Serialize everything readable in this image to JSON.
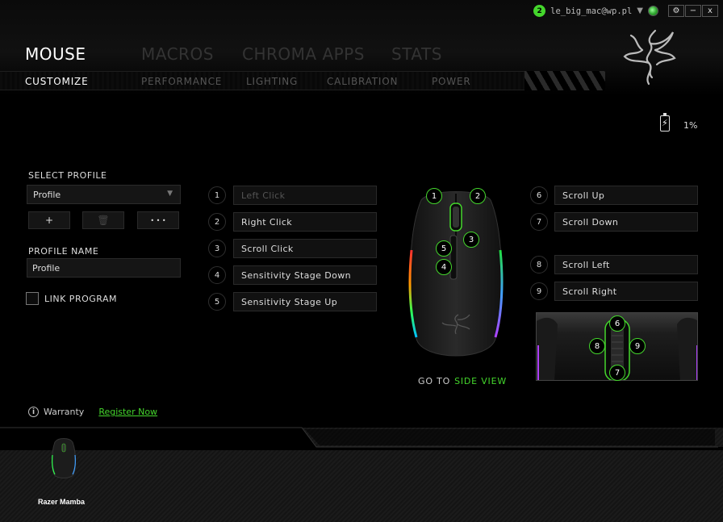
{
  "topbar": {
    "notifications": "2",
    "username": "le_big_mac@wp.pl",
    "settings_label": "⚙",
    "minimize_label": "−",
    "close_label": "x"
  },
  "main_tabs": [
    {
      "label": "MOUSE",
      "active": true
    },
    {
      "label": "MACROS",
      "active": false
    },
    {
      "label": "CHROMA APPS",
      "active": false
    },
    {
      "label": "STATS",
      "active": false
    }
  ],
  "sub_tabs": [
    {
      "label": "CUSTOMIZE",
      "active": true
    },
    {
      "label": "PERFORMANCE",
      "active": false
    },
    {
      "label": "LIGHTING",
      "active": false
    },
    {
      "label": "CALIBRATION",
      "active": false
    },
    {
      "label": "POWER",
      "active": false
    }
  ],
  "battery": {
    "level_percent": 1,
    "label": "1%"
  },
  "profile": {
    "select_label": "SELECT PROFILE",
    "selected": "Profile",
    "add_label": "+",
    "delete_label": "🗑",
    "more_label": "• • •",
    "name_label": "PROFILE NAME",
    "name_value": "Profile",
    "link_program_label": "LINK PROGRAM",
    "link_program_checked": false
  },
  "buttons_left": [
    {
      "num": "1",
      "action": "Left Click",
      "disabled": true
    },
    {
      "num": "2",
      "action": "Right Click",
      "disabled": false
    },
    {
      "num": "3",
      "action": "Scroll Click",
      "disabled": false
    },
    {
      "num": "4",
      "action": "Sensitivity Stage Down",
      "disabled": false
    },
    {
      "num": "5",
      "action": "Sensitivity Stage Up",
      "disabled": false
    }
  ],
  "buttons_right": [
    {
      "num": "6",
      "action": "Scroll Up"
    },
    {
      "num": "7",
      "action": "Scroll Down"
    },
    {
      "num": "8",
      "action": "Scroll Left"
    },
    {
      "num": "9",
      "action": "Scroll Right"
    }
  ],
  "goto": {
    "prefix": "GO TO",
    "link": "SIDE VIEW"
  },
  "warranty": {
    "label": "Warranty",
    "link": "Register Now"
  },
  "device": {
    "name": "Razer Mamba"
  },
  "colors": {
    "accent": "#44d62c"
  }
}
